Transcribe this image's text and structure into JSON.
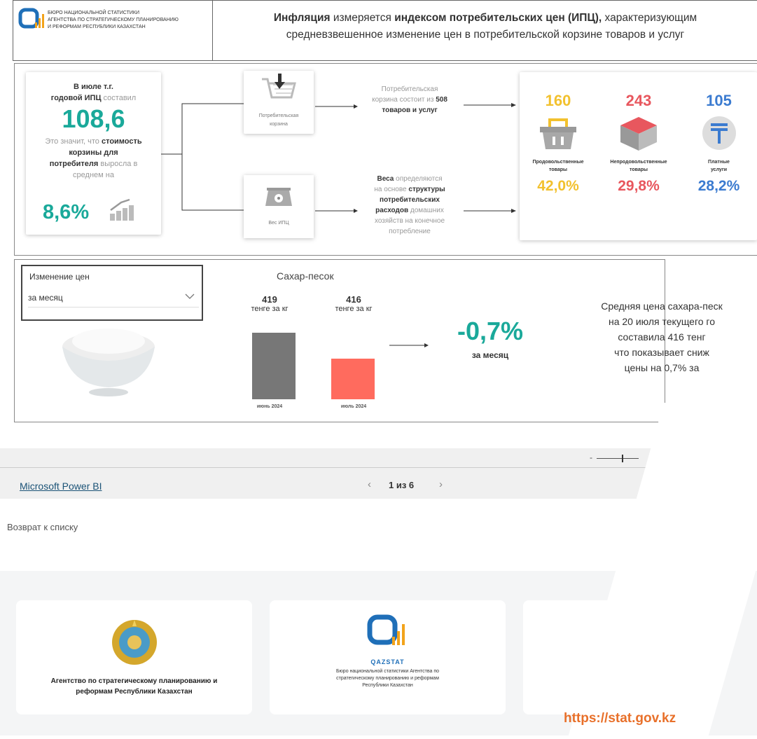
{
  "header": {
    "org_lines": [
      "БЮРО НАЦИОНАЛЬНОЙ СТАТИСТИКИ",
      "АГЕНТСТВА ПО СТРАТЕГИЧЕСКОМУ ПЛАНИРОВАНИЮ",
      "И РЕФОРМАМ РЕСПУБЛИКИ КАЗАХСТАН"
    ],
    "logo_text": "QAZSTAT",
    "t1": "Инфляция",
    "t2": " измеряется ",
    "t3": "индексом потребительских цен (ИПЦ),",
    "t4": " характеризующим",
    "t5": "средневзвешенное изменение цен в потребительской корзине товаров и услуг"
  },
  "cpi": {
    "l1": "В июле т.г.",
    "l2a": "годовой ИПЦ",
    "l2b": " составил",
    "value": "108,6",
    "l3a": "Это значит, что ",
    "l3b": "стоимость",
    "l4": "корзины для",
    "l5a": "потребителя",
    "l5b": " выросла в",
    "l6": "среднем на",
    "pct": "8,6%"
  },
  "basket": {
    "label1": "Потребительская",
    "label2": "корзина",
    "text1": "Потребительская",
    "text2a": "корзина состоит из ",
    "text2b": "508",
    "text3": "товаров и услуг"
  },
  "weights": {
    "label": "Вес ИПЦ",
    "a": "Веса",
    "b": " определяются",
    "c": "на основе ",
    "d": "структуры",
    "e": "потребительских",
    "f": "расходов",
    "g": " домашних",
    "h": "хозяйств на конечное",
    "i": "потребление"
  },
  "categories": [
    {
      "count": "160",
      "name1": "Продовольственные",
      "name2": "товары",
      "pct": "42,0%",
      "color": "#f2c12e",
      "icon": "basket-icon"
    },
    {
      "count": "243",
      "name1": "Непродовольственные",
      "name2": "товары",
      "pct": "29,8%",
      "color": "#e8575e",
      "icon": "box-icon"
    },
    {
      "count": "105",
      "name1": "Платные",
      "name2": "услуги",
      "pct": "28,2%",
      "color": "#3b7bd0",
      "icon": "tenge-icon"
    }
  ],
  "filter": {
    "label": "Изменение цен",
    "value": "за месяц"
  },
  "sugar": {
    "title": "Сахар-песок",
    "bar1_value": "419",
    "bar1_unit": "тенге за кг",
    "bar1_label": "июнь 2024",
    "bar2_value": "416",
    "bar2_unit": "тенге за кг",
    "bar2_label": "июль 2024",
    "change": "-0,7%",
    "change_label": "за месяц",
    "desc": [
      "Средняя цена сахара-песк",
      "на 20 июля текущего го",
      "составила 416 тенг",
      "что показывает сниж",
      "цены на 0,7% за"
    ]
  },
  "chart_data": {
    "type": "bar",
    "categories": [
      "июнь 2024",
      "июль 2024"
    ],
    "values": [
      419,
      416
    ],
    "title": "Сахар-песок",
    "colors": [
      "#777777",
      "#ff6b5e"
    ]
  },
  "powerbi": {
    "link": "Microsoft Power BI",
    "pager": "1 из 6",
    "prev": "‹",
    "next": "›",
    "zoom_minus": "-"
  },
  "back_link": "Возврат к списку",
  "orgs": [
    {
      "name1": "Агентство по стратегическому планированию и",
      "name2": "реформам Республики Казахстан"
    },
    {
      "logo": "QAZSTAT",
      "name1": "Бюро национальной статистики Агентства по",
      "name2": "стратегическому планированию и реформам",
      "name3": "Республики Казахстан"
    }
  ],
  "url": "https://stat.gov.kz"
}
